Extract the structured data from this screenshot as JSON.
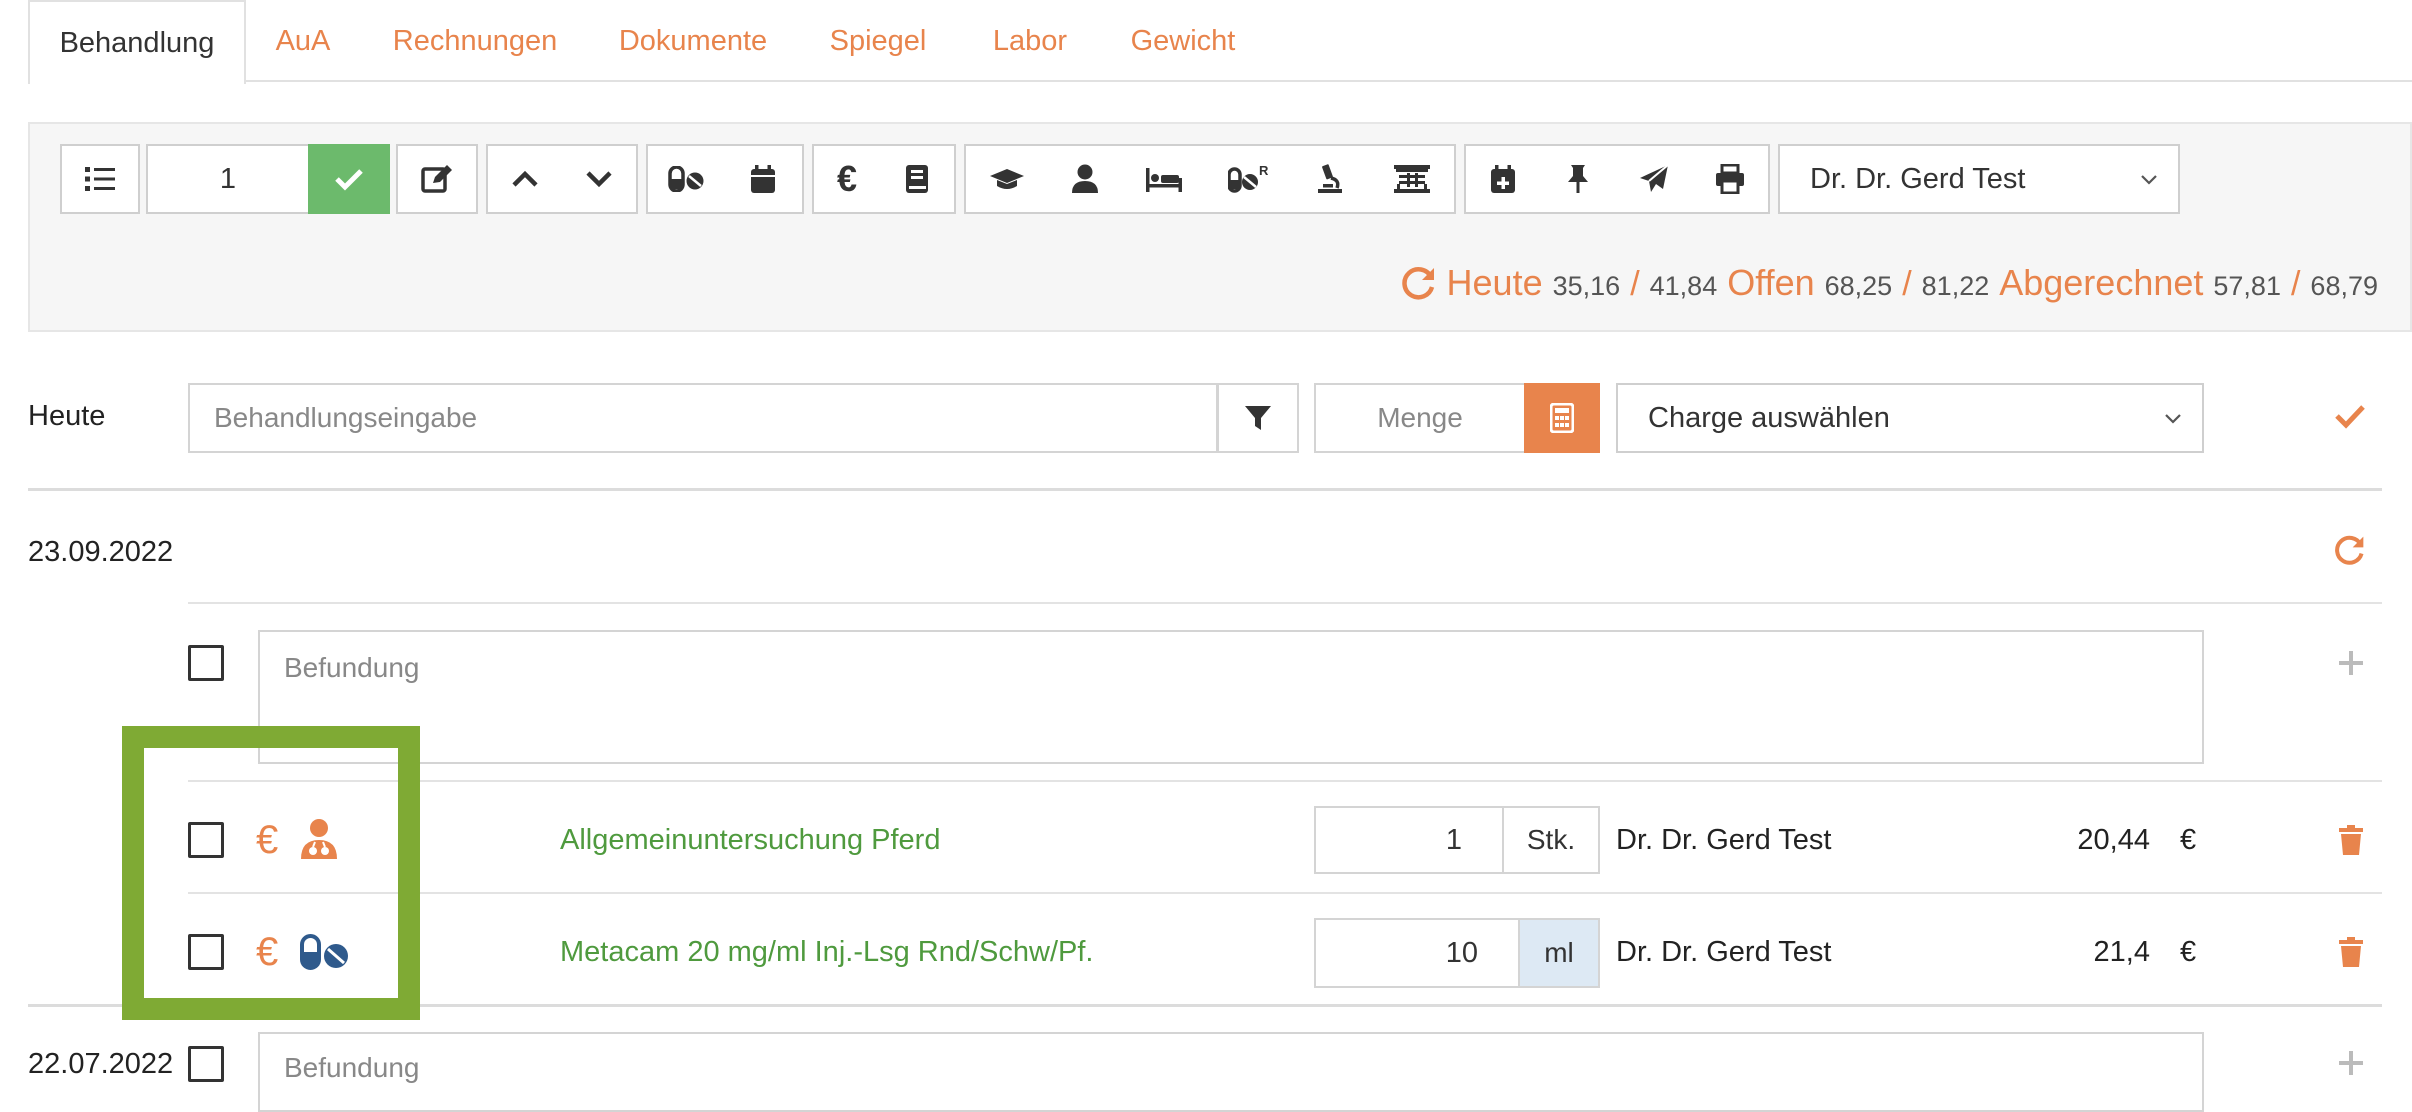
{
  "tabs": [
    {
      "label": "Behandlung",
      "active": true
    },
    {
      "label": "AuA"
    },
    {
      "label": "Rechnungen"
    },
    {
      "label": "Dokumente"
    },
    {
      "label": "Spiegel"
    },
    {
      "label": "Labor"
    },
    {
      "label": "Gewicht"
    }
  ],
  "toolbar": {
    "quantity_value": "1",
    "doctor_select": "Dr. Dr. Gerd Test",
    "icons": [
      "list-icon",
      "check-icon",
      "edit-icon",
      "chevron-up-icon",
      "chevron-down-icon",
      "pills-icon",
      "calendar-icon",
      "euro-icon",
      "book-icon",
      "graduation-cap-icon",
      "user-icon",
      "bed-icon",
      "prescription-pills-icon",
      "microscope-icon",
      "cash-register-icon",
      "calendar-plus-icon",
      "pin-icon",
      "send-icon",
      "print-icon"
    ],
    "rx_superscript": "R"
  },
  "totals": {
    "heute_label": "Heute",
    "heute_a": "35,16",
    "heute_b": "41,84",
    "offen_label": "Offen",
    "offen_a": "68,25",
    "offen_b": "81,22",
    "abgerechnet_label": "Abgerechnet",
    "abgerechnet_a": "57,81",
    "abgerechnet_b": "68,79",
    "separator": "/"
  },
  "entry": {
    "date_label": "Heute",
    "treatment_placeholder": "Behandlungseingabe",
    "quantity_placeholder": "Menge",
    "charge_select": "Charge auswählen"
  },
  "sections": [
    {
      "date": "23.09.2022",
      "befund_placeholder": "Befundung",
      "rows": [
        {
          "name": "Allgemeinuntersuchung Pferd",
          "qty": "1",
          "unit": "Stk.",
          "doctor": "Dr. Dr. Gerd Test",
          "price": "20,44",
          "currency": "€",
          "billing_icon": "€",
          "type_icon": "doctor-icon"
        },
        {
          "name": "Metacam 20 mg/ml Inj.-Lsg Rnd/Schw/Pf.",
          "qty": "10",
          "unit": "ml",
          "doctor": "Dr. Dr. Gerd Test",
          "price": "21,4",
          "currency": "€",
          "billing_icon": "€",
          "type_icon": "pills-icon"
        }
      ]
    },
    {
      "date": "22.07.2022",
      "befund_placeholder": "Befundung"
    }
  ],
  "colors": {
    "accent": "#e8844c",
    "success": "#6cba6c",
    "name_green": "#4f9a3e",
    "highlight": "#7faa34",
    "pill_blue": "#2f5a8c"
  }
}
